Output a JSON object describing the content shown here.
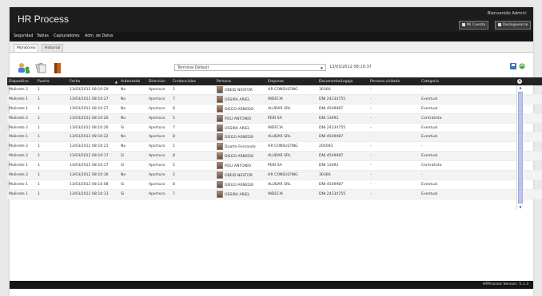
{
  "header": {
    "title": "HR Process",
    "welcome": "Bienvenido Admin!",
    "account_button": "Mi Cuenta",
    "logout_button": "Desloguearse"
  },
  "menu": [
    "Seguridad",
    "Tablas",
    "Capturadores",
    "Adm. de Datos"
  ],
  "tabs": [
    {
      "label": "Monitoreo",
      "active": true
    },
    {
      "label": "Historial",
      "active": false
    }
  ],
  "toolbar": {
    "icons": [
      "users-icon",
      "documents-icon",
      "door-exit-icon"
    ],
    "terminal_value": "Terminal Default",
    "timestamp": "13/03/2012 08:10:37",
    "right_icons": [
      "save-icon",
      "refresh-icon"
    ]
  },
  "grid": {
    "columns": [
      "Dispositivo",
      "Puerta",
      "Fecha",
      "Autorizado",
      "Direccion",
      "Credenciales",
      "Persona",
      "Empresa",
      "Documento/Legajo",
      "Persona visitada",
      "Categoria"
    ],
    "rows": [
      [
        "Molinete 2",
        "1",
        "13/03/2012 08:10:29",
        "No",
        "Apertura",
        "2",
        "OBEID NESTOR",
        "HR CONSULTING",
        "30366",
        "-",
        "-"
      ],
      [
        "Molinete 1",
        "1",
        "13/03/2012 08:10:27",
        "No",
        "Apertura",
        "7",
        "OSSIRA ARIEL",
        "INDECIA",
        "DNI 24234755",
        "-",
        "Eventual"
      ],
      [
        "Molinete 1",
        "1",
        "13/03/2012 08:10:27",
        "No",
        "Apertura",
        "8",
        "DIEGO ARNEDO",
        "ALUDAR SRL",
        "DNI 4549987",
        "-",
        "Eventual"
      ],
      [
        "Molinete 2",
        "1",
        "13/03/2012 08:10:26",
        "No",
        "Apertura",
        "5",
        "POLI ANTONIO",
        "PEBI SA",
        "DNI 13492",
        "-",
        "Contratista"
      ],
      [
        "Molinete 2",
        "1",
        "13/03/2012 08:10:26",
        "Si",
        "Apertura",
        "7",
        "OSSIRA ARIEL",
        "INDECIA",
        "DNI 24234755",
        "-",
        "Eventual"
      ],
      [
        "Molinete 1",
        "1",
        "13/03/2012 08:10:22",
        "No",
        "Apertura",
        "8",
        "DIEGO ARNEDO",
        "ALUDAR SRL",
        "DNI 4549987",
        "-",
        "Eventual"
      ],
      [
        "Molinete 2",
        "1",
        "13/03/2012 08:10:21",
        "No",
        "Apertura",
        "1",
        "Duarte Fernando",
        "HR CONSULTING",
        "204081",
        "-",
        "-"
      ],
      [
        "Molinete 2",
        "1",
        "13/03/2012 08:10:17",
        "Si",
        "Apertura",
        "8",
        "DIEGO ARNEDO",
        "ALUDAR SRL",
        "DNI 4549987",
        "-",
        "Eventual"
      ],
      [
        "Molinete 1",
        "1",
        "13/03/2012 08:10:17",
        "Si",
        "Apertura",
        "5",
        "POLI ANTONIO",
        "PEBI SA",
        "DNI 13492",
        "-",
        "Contratista"
      ],
      [
        "Molinete 2",
        "1",
        "13/03/2012 08:10:16",
        "No",
        "Apertura",
        "2",
        "OBEID NESTOR",
        "HR CONSULTING",
        "30366",
        "-",
        "-"
      ],
      [
        "Molinete 1",
        "1",
        "13/03/2012 08:10:08",
        "Si",
        "Apertura",
        "8",
        "DIEGO ARNEDO",
        "ALUDAR SRL",
        "DNI 4549987",
        "-",
        "Eventual"
      ],
      [
        "Molinete 1",
        "1",
        "13/03/2012 08:10:13",
        "Si",
        "Apertura",
        "7",
        "OSSIRA ARIEL",
        "INDECIA",
        "DNI 24234755",
        "-",
        "Eventual"
      ]
    ]
  },
  "footer": {
    "version": "HRProcess Version: 5.1.3"
  },
  "colors": {
    "header_bg": "#1d1d1d",
    "scroll_thumb": "#b9c6f0",
    "page_bg": "#e9e9e9"
  }
}
